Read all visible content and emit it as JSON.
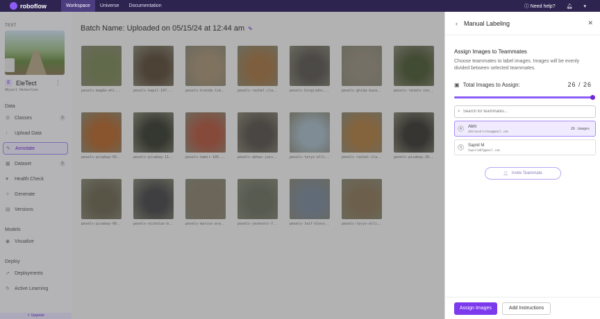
{
  "topbar": {
    "brand": "roboflow",
    "tabs": [
      "Workspace",
      "Universe",
      "Documentation"
    ],
    "help": "Need help?"
  },
  "sidebar": {
    "workspace_label": "TEST",
    "project_name": "EleTect",
    "project_initial": "E",
    "project_type": "Object Detection",
    "sections": [
      {
        "title": "Data",
        "items": [
          {
            "label": "Classes",
            "icon": "list-icon",
            "badge": "0"
          },
          {
            "label": "Upload Data",
            "icon": "upload-icon"
          },
          {
            "label": "Annotate",
            "icon": "pen-icon",
            "active": true
          },
          {
            "label": "Dataset",
            "icon": "image-icon",
            "badge": "0"
          },
          {
            "label": "Health Check",
            "icon": "health-icon"
          },
          {
            "label": "Generate",
            "icon": "sparkle-icon"
          },
          {
            "label": "Versions",
            "icon": "versions-icon"
          }
        ]
      },
      {
        "title": "Models",
        "items": [
          {
            "label": "Visualize",
            "icon": "eye-icon"
          }
        ]
      },
      {
        "title": "Deploy",
        "items": [
          {
            "label": "Deployments",
            "icon": "rocket-icon"
          },
          {
            "label": "Active Learning",
            "icon": "loop-icon"
          }
        ]
      }
    ],
    "upgrade": "Upgrade"
  },
  "main": {
    "batch_title": "Batch Name: Uploaded on 05/15/24 at 12:44 am",
    "images": [
      {
        "caption": "pexels-magda-ehl...",
        "color": "#7d8a5a"
      },
      {
        "caption": "pexels-kapil-107...",
        "color": "#5f4f3d"
      },
      {
        "caption": "pexels-brenda-tim...",
        "color": "#a9957a"
      },
      {
        "caption": "pexels-rachel-cla...",
        "color": "#a57a4a"
      },
      {
        "caption": "pexels-bingirphs...",
        "color": "#5e5a56"
      },
      {
        "caption": "pexels-ghida-kaza...",
        "color": "#9a9283"
      },
      {
        "caption": "pexels-renato-con...",
        "color": "#4f5c3a"
      },
      {
        "caption": "pexels-pixabay-65...",
        "color": "#b56a32"
      },
      {
        "caption": "pexels-pixabay-11...",
        "color": "#3c3f35"
      },
      {
        "caption": "pexels-hamir-105...",
        "color": "#b35b45"
      },
      {
        "caption": "pexels-abhas-jais...",
        "color": "#5a5550"
      },
      {
        "caption": "pexels-tarys-elli...",
        "color": "#a9bcc9"
      },
      {
        "caption": "pexels-rachel-cla...",
        "color": "#b08047"
      },
      {
        "caption": "pexels-pixabay-26...",
        "color": "#3e3c37"
      },
      {
        "caption": "pexels-pixabay-60...",
        "color": "#6f6a55"
      },
      {
        "caption": "pexels-nicholas-b...",
        "color": "#4a4b4d"
      },
      {
        "caption": "pexels-marcos-ara...",
        "color": "#8c8270"
      },
      {
        "caption": "pexels-jeshoots-7...",
        "color": "#6d7364"
      },
      {
        "caption": "pexels-leif-bless...",
        "color": "#7d8b9c"
      },
      {
        "caption": "pexels-tarys-elli...",
        "color": "#8d7a5c"
      }
    ]
  },
  "panel": {
    "title": "Manual Labeling",
    "assign_heading": "Assign Images to Teammates",
    "assign_desc": "Choose teammates to label images. Images will be evenly divided between selected teammates.",
    "total_label": "Total Images to Assign:",
    "total_assigned": "26",
    "total_available": "26",
    "assigned_fraction": 1.0,
    "search_placeholder": "Search for teammates...",
    "teammates": [
      {
        "initial": "A",
        "name": "Abhi",
        "email": "abhinavkrishna@gmail.com",
        "images": "26 images",
        "selected": true
      },
      {
        "initial": "S",
        "name": "Sapnil M",
        "email": "Sapnilm07@gmail.com",
        "images": "",
        "selected": false
      }
    ],
    "invite_label": "Invite Teammate",
    "assign_button": "Assign Images",
    "instructions_button": "Add Instructions"
  },
  "colors": {
    "brand": "#7c3aed",
    "topbar": "#2d2450"
  }
}
